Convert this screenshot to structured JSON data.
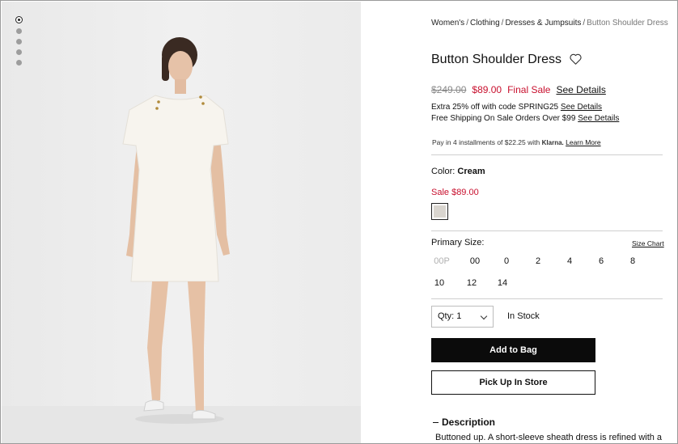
{
  "gallery": {
    "dots": [
      "active",
      "",
      "",
      "",
      ""
    ]
  },
  "breadcrumb": {
    "items": [
      "Women's",
      "Clothing",
      "Dresses & Jumpsuits"
    ],
    "current": "Button Shoulder Dress",
    "separator": "/"
  },
  "product": {
    "title": "Button Shoulder Dress",
    "original_price": "$249.00",
    "sale_price": "$89.00",
    "final_sale": "Final Sale",
    "see_details": "See Details"
  },
  "promos": {
    "promo1_text": "Extra 25% off with code SPRING25",
    "promo1_link": "See Details",
    "promo2_text": "Free Shipping On Sale Orders Over $99",
    "promo2_link": "See Details"
  },
  "klarna": {
    "text": "Pay in 4 installments of $22.25 with",
    "brand": "Klarna.",
    "link": "Learn More"
  },
  "color": {
    "label": "Color:",
    "value": "Cream",
    "sale_price": "Sale $89.00",
    "swatch_color": "#d9d5cf"
  },
  "size": {
    "label": "Primary Size:",
    "chart_link": "Size Chart",
    "options": [
      "00P",
      "00",
      "0",
      "2",
      "4",
      "6",
      "8",
      "10",
      "12",
      "14"
    ],
    "out_of_stock": [
      "00P"
    ]
  },
  "purchase": {
    "qty_label": "Qty: 1",
    "stock": "In Stock",
    "add_to_bag": "Add to Bag",
    "pickup": "Pick Up In Store"
  },
  "description": {
    "heading": "Description",
    "text": "Buttoned up. A short-sleeve sheath dress is refined with a"
  },
  "colors": {
    "sale_red": "#c8102e",
    "button_black": "#0b0b0b"
  }
}
